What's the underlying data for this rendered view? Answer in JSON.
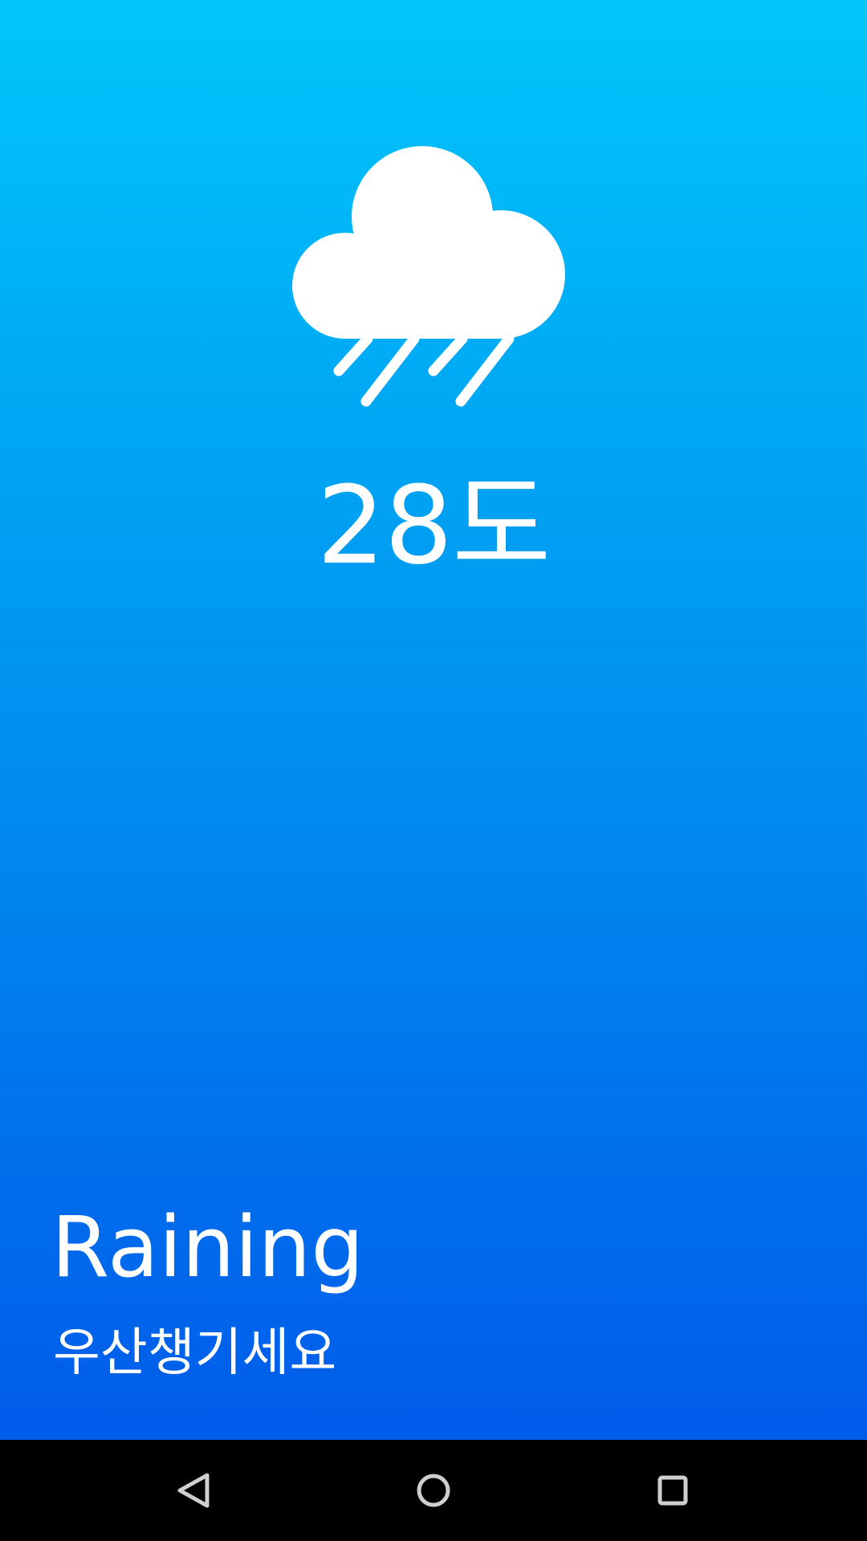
{
  "weather": {
    "icon": "cloud-rain-icon",
    "temperature": "28도",
    "condition": "Raining",
    "message": "우산챙기세요"
  },
  "colors": {
    "gradient_top": "#00C6FB",
    "gradient_bottom": "#005BEA",
    "text": "#FFFFFF",
    "nav_bar": "#000000"
  },
  "navigation": {
    "back_icon": "back-triangle-icon",
    "home_icon": "home-circle-icon",
    "recents_icon": "recents-square-icon"
  }
}
